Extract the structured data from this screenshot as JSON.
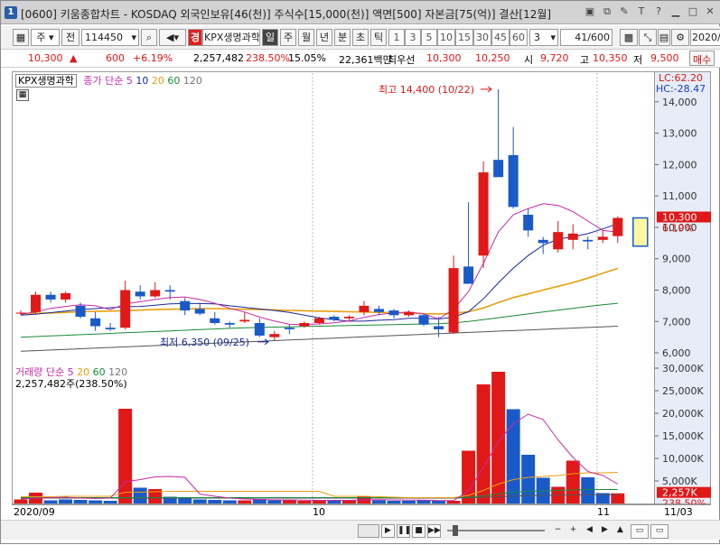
{
  "window": {
    "badge": "1",
    "title": "[0600] 키움종합차트 - KOSDAQ 외국인보유[46(천)] 주식수[15,000(천)] 액면[500] 자본금[75(억)] 결산[12월]",
    "icons": [
      "window-icon",
      "copy-icon",
      "pin-icon",
      "text-icon",
      "help-icon",
      "minimize-icon",
      "maximize-icon",
      "close-icon"
    ]
  },
  "toolbar": {
    "market": "주",
    "prev_label": "전",
    "code": "114450",
    "badge": "경",
    "stock_name": "KPX생명과학",
    "periods": [
      "일",
      "주",
      "월",
      "년",
      "분",
      "초",
      "틱"
    ],
    "active_period": "일",
    "intervals": [
      "1",
      "3",
      "5",
      "10",
      "15",
      "30",
      "45",
      "60"
    ],
    "interval_value": "3",
    "count": "41",
    "count_max": "/600",
    "date": "2020/"
  },
  "quote": {
    "price": "10,300",
    "arrow": "▲",
    "change": "600",
    "change_pct": "+6.19%",
    "volume": "2,257,482",
    "volume_pct": "238.50%",
    "turnover": "15.05%",
    "amount": "22,361백만",
    "best_label": "최우선",
    "ask": "10,300",
    "bid": "10,250",
    "open_label": "시",
    "open": "9,720",
    "high_label": "고",
    "high": "10,350",
    "low_label": "저",
    "low": "9,500",
    "trade_label": "매수"
  },
  "price_panel": {
    "name": "KPX생명과학",
    "ma_label": "종가 단순",
    "ma_periods": [
      "5",
      "10",
      "20",
      "60",
      "120"
    ],
    "ma_colors": [
      "#c82aa8",
      "#1a2a9a",
      "#e8a010",
      "#1a8a3a",
      "#555555"
    ],
    "lc": "LC:62.20",
    "hc": "HC:-28.47",
    "current_price": "10,300",
    "current_pct": "6.19%",
    "max_note": "최고 14,400 (10/22)",
    "min_note": "최저 6,350 (09/25)"
  },
  "volume_panel": {
    "label": "거래량 단순",
    "ma_periods": [
      "5",
      "20",
      "60",
      "120"
    ],
    "ma_colors": [
      "#c82aa8",
      "#e8a010",
      "#1a8a3a",
      "#555555"
    ],
    "value_line": "2,257,482주(238.50%)",
    "current_volume": "2,257K",
    "current_pct": "238.50%"
  },
  "xaxis": {
    "labels": [
      "2020/09",
      "10",
      "11",
      "11/03"
    ]
  },
  "chart_data": [
    {
      "type": "candlestick",
      "title": "KPX생명과학",
      "ylim": [
        5800,
        14800
      ],
      "y_ticks": [
        6000,
        7000,
        8000,
        9000,
        10000,
        11000,
        12000,
        13000,
        14000
      ],
      "y_tick_labels": [
        "6,000",
        "7,000",
        "8,000",
        "9,000",
        "10,000",
        "11,000",
        "12,000",
        "13,000",
        "14,000"
      ],
      "up_color": "#e01818",
      "down_color": "#1a5ac8",
      "ohlc": [
        [
          7250,
          7350,
          7200,
          7280
        ],
        [
          7300,
          7950,
          7250,
          7850
        ],
        [
          7850,
          7950,
          7600,
          7700
        ],
        [
          7700,
          7950,
          7600,
          7900
        ],
        [
          7500,
          7600,
          7100,
          7150
        ],
        [
          7100,
          7300,
          6700,
          6850
        ],
        [
          6800,
          6950,
          6700,
          6750
        ],
        [
          6800,
          8300,
          6750,
          8000
        ],
        [
          7950,
          8150,
          7700,
          7800
        ],
        [
          7800,
          8250,
          7750,
          8000
        ],
        [
          8000,
          8150,
          7700,
          7950
        ],
        [
          7650,
          7750,
          7200,
          7350
        ],
        [
          7400,
          7600,
          7200,
          7250
        ],
        [
          7100,
          7300,
          6900,
          6950
        ],
        [
          6950,
          7000,
          6800,
          6900
        ],
        [
          7000,
          7300,
          6950,
          7050
        ],
        [
          6950,
          7100,
          6500,
          6550
        ],
        [
          6500,
          6700,
          6400,
          6600
        ],
        [
          6800,
          6900,
          6600,
          6750
        ],
        [
          6850,
          7000,
          6800,
          6950
        ],
        [
          6950,
          7150,
          6900,
          7100
        ],
        [
          7150,
          7200,
          7000,
          7050
        ],
        [
          7100,
          7200,
          7000,
          7150
        ],
        [
          7300,
          7650,
          7200,
          7500
        ],
        [
          7400,
          7500,
          7200,
          7300
        ],
        [
          7350,
          7400,
          7100,
          7200
        ],
        [
          7200,
          7350,
          7150,
          7300
        ],
        [
          7200,
          7250,
          6850,
          6900
        ],
        [
          6850,
          7150,
          6500,
          6750
        ],
        [
          6650,
          9100,
          6600,
          8700
        ],
        [
          8750,
          10800,
          8400,
          8200
        ],
        [
          9100,
          12100,
          8700,
          11750
        ],
        [
          12150,
          14400,
          11850,
          11600
        ],
        [
          12300,
          13200,
          10600,
          10650
        ],
        [
          10400,
          10600,
          9700,
          9900
        ],
        [
          9600,
          9700,
          9150,
          9500
        ],
        [
          9300,
          10200,
          9200,
          9850
        ],
        [
          9600,
          10100,
          9300,
          9800
        ],
        [
          9600,
          9700,
          9300,
          9550
        ],
        [
          9600,
          9900,
          9500,
          9700
        ],
        [
          9720,
          10350,
          9500,
          10300
        ]
      ],
      "ma5": [
        7230,
        7300,
        7420,
        7480,
        7530,
        7500,
        7380,
        7560,
        7630,
        7700,
        7760,
        7780,
        7700,
        7580,
        7420,
        7300,
        7140,
        7010,
        6910,
        6900,
        6920,
        6960,
        7020,
        7130,
        7220,
        7270,
        7300,
        7240,
        7080,
        7390,
        7950,
        8850,
        9850,
        10400,
        10600,
        10750,
        10700,
        10500,
        10200,
        9900,
        9850
      ],
      "ma10": [
        7200,
        7230,
        7280,
        7330,
        7380,
        7410,
        7440,
        7470,
        7480,
        7520,
        7560,
        7570,
        7570,
        7560,
        7500,
        7450,
        7400,
        7350,
        7290,
        7200,
        7110,
        7060,
        7010,
        7010,
        7040,
        7060,
        7100,
        7100,
        7080,
        7140,
        7310,
        7720,
        8230,
        8700,
        9100,
        9430,
        9620,
        9700,
        9800,
        9950,
        10120
      ],
      "ma20": [
        7250,
        7260,
        7270,
        7290,
        7310,
        7320,
        7330,
        7340,
        7360,
        7380,
        7390,
        7400,
        7410,
        7410,
        7400,
        7390,
        7380,
        7370,
        7350,
        7340,
        7330,
        7320,
        7310,
        7300,
        7290,
        7280,
        7270,
        7250,
        7240,
        7260,
        7310,
        7430,
        7600,
        7760,
        7880,
        8000,
        8120,
        8240,
        8380,
        8540,
        8690
      ],
      "ma60": [
        6500,
        6520,
        6540,
        6560,
        6580,
        6600,
        6620,
        6640,
        6660,
        6680,
        6700,
        6720,
        6740,
        6760,
        6780,
        6800,
        6810,
        6820,
        6830,
        6840,
        6850,
        6860,
        6870,
        6880,
        6890,
        6900,
        6910,
        6920,
        6930,
        6960,
        7000,
        7060,
        7120,
        7180,
        7240,
        7300,
        7360,
        7420,
        7480,
        7530,
        7580
      ],
      "ma120": [
        6050,
        6070,
        6090,
        6110,
        6130,
        6150,
        6170,
        6190,
        6210,
        6230,
        6250,
        6270,
        6290,
        6310,
        6330,
        6350,
        6370,
        6390,
        6410,
        6430,
        6450,
        6470,
        6490,
        6510,
        6530,
        6550,
        6570,
        6590,
        6610,
        6630,
        6650,
        6670,
        6690,
        6710,
        6730,
        6750,
        6770,
        6790,
        6810,
        6830,
        6850
      ]
    },
    {
      "type": "bar",
      "title": "거래량",
      "ylim": [
        0,
        31000
      ],
      "y_ticks": [
        5000,
        10000,
        15000,
        20000,
        25000,
        30000
      ],
      "y_tick_labels": [
        "5,000K",
        "10,000K",
        "15,000K",
        "20,000K",
        "25,000K",
        "30,000K"
      ],
      "values_k": [
        900,
        2400,
        700,
        900,
        800,
        700,
        600,
        21000,
        3500,
        3200,
        1500,
        1200,
        900,
        800,
        700,
        700,
        1000,
        700,
        700,
        600,
        700,
        700,
        800,
        1500,
        700,
        600,
        600,
        700,
        600,
        600,
        11700,
        26400,
        29200,
        20900,
        10800,
        5700,
        3700,
        9500,
        5800,
        2300,
        2257
      ],
      "colors": [
        "r",
        "r",
        "b",
        "b",
        "b",
        "b",
        "b",
        "r",
        "b",
        "r",
        "b",
        "b",
        "b",
        "b",
        "b",
        "r",
        "b",
        "b",
        "r",
        "r",
        "r",
        "b",
        "r",
        "r",
        "b",
        "b",
        "b",
        "b",
        "b",
        "r",
        "r",
        "r",
        "r",
        "b",
        "b",
        "b",
        "r",
        "r",
        "b",
        "b",
        "r"
      ],
      "ma5": [
        1000,
        1200,
        1300,
        1400,
        1200,
        1100,
        1200,
        4800,
        5300,
        5900,
        6000,
        5800,
        2100,
        1600,
        1200,
        1000,
        900,
        800,
        800,
        750,
        700,
        700,
        700,
        800,
        850,
        800,
        750,
        750,
        650,
        650,
        2800,
        8000,
        13700,
        17700,
        19800,
        18600,
        14100,
        10200,
        7100,
        6200,
        4300
      ],
      "ma20": [
        1500,
        1500,
        1500,
        1600,
        1600,
        1600,
        1600,
        2500,
        2500,
        2600,
        2700,
        2700,
        2700,
        2700,
        2700,
        2700,
        2700,
        2700,
        2700,
        2700,
        2700,
        1600,
        1600,
        1600,
        1500,
        1400,
        1300,
        1300,
        1300,
        1300,
        1800,
        2900,
        4300,
        5300,
        5800,
        6000,
        6200,
        6600,
        6800,
        6800,
        6900
      ],
      "ma60": [
        1300,
        1300,
        1300,
        1300,
        1300,
        1300,
        1300,
        1300,
        1300,
        1300,
        1300,
        1300,
        1300,
        1300,
        1300,
        1300,
        1300,
        1300,
        1300,
        1300,
        1300,
        1300,
        1300,
        1300,
        1300,
        1300,
        1300,
        1300,
        1300,
        1300,
        1400,
        1700,
        2100,
        2500,
        2700,
        2800,
        2900,
        3000,
        3100,
        3100,
        3100
      ],
      "ma120": [
        1200,
        1200,
        1200,
        1200,
        1200,
        1200,
        1200,
        1200,
        1200,
        1200,
        1200,
        1200,
        1200,
        1200,
        1200,
        1200,
        1200,
        1200,
        1200,
        1200,
        1200,
        1200,
        1200,
        1200,
        1200,
        1200,
        1200,
        1200,
        1200,
        1200,
        1250,
        1350,
        1500,
        1650,
        1750,
        1800,
        1850,
        1900,
        1950,
        1980,
        2000
      ]
    }
  ]
}
